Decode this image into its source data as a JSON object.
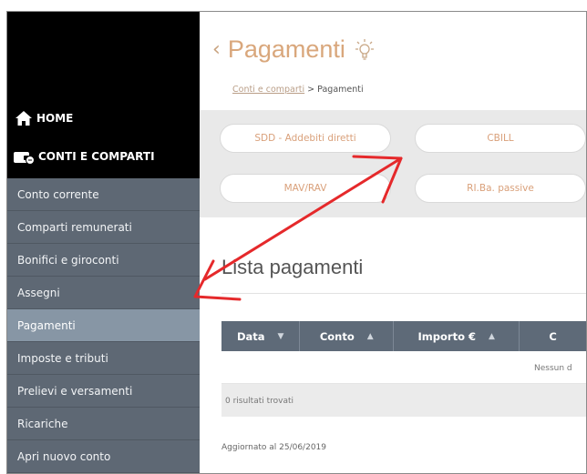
{
  "sidebar": {
    "home_label": "HOME",
    "conti_label": "CONTI E COMPARTI",
    "items": [
      {
        "label": "Conto corrente"
      },
      {
        "label": "Comparti remunerati"
      },
      {
        "label": "Bonifici e giroconti"
      },
      {
        "label": "Assegni"
      },
      {
        "label": "Pagamenti"
      },
      {
        "label": "Imposte e tributi"
      },
      {
        "label": "Prelievi e versamenti"
      },
      {
        "label": "Ricariche"
      },
      {
        "label": "Apri nuovo conto"
      }
    ],
    "active_item": "Pagamenti"
  },
  "header": {
    "back_glyph": "‹",
    "title": "Pagamenti",
    "breadcrumb_link": "Conti e comparti",
    "breadcrumb_sep": ">",
    "breadcrumb_current": "Pagamenti"
  },
  "payment_buttons": [
    {
      "label": "SDD - Addebiti diretti"
    },
    {
      "label": "CBILL"
    },
    {
      "label": "MAV/RAV"
    },
    {
      "label": "RI.Ba. passive"
    }
  ],
  "section": {
    "title": "Lista pagamenti"
  },
  "table": {
    "columns": [
      {
        "label": "Data",
        "sort": "▼"
      },
      {
        "label": "Conto",
        "sort": "▲"
      },
      {
        "label": "Importo €",
        "sort": "▲"
      },
      {
        "label": "C",
        "sort": ""
      }
    ],
    "empty_text": "Nessun d",
    "results_text": "0 risultati trovati"
  },
  "footer": {
    "updated_text": "Aggiornato al 25/06/2019"
  },
  "colors": {
    "sidebar_bg": "#5e6874",
    "sidebar_active": "#8796a5",
    "accent": "#d9a77c",
    "table_header": "#5e6a78",
    "arrow": "#e5292b"
  }
}
